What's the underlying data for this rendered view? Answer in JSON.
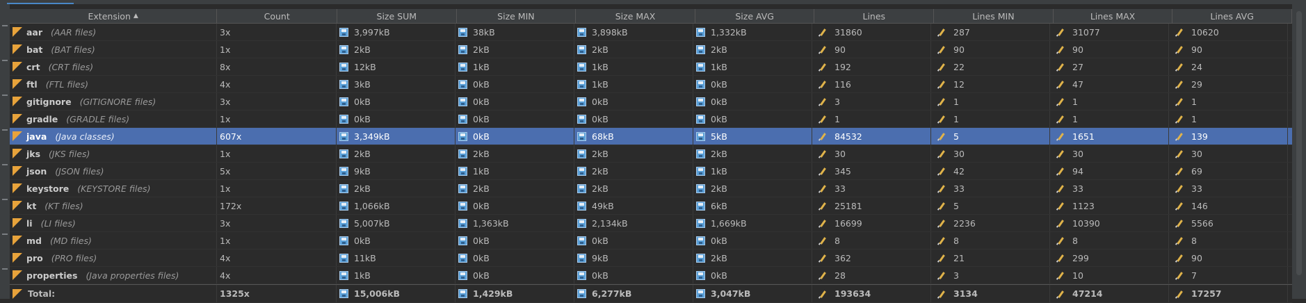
{
  "columns": [
    "Extension",
    "Count",
    "Size SUM",
    "Size MIN",
    "Size MAX",
    "Size AVG",
    "Lines",
    "Lines MIN",
    "Lines MAX",
    "Lines AVG"
  ],
  "sort_indicator": "▲",
  "rows": [
    {
      "ext": "aar",
      "desc": "(AAR files)",
      "count": "3x",
      "size_sum": "3,997kB",
      "size_min": "38kB",
      "size_max": "3,898kB",
      "size_avg": "1,332kB",
      "lines": "31860",
      "lines_min": "287",
      "lines_max": "31077",
      "lines_avg": "10620"
    },
    {
      "ext": "bat",
      "desc": "(BAT files)",
      "count": "1x",
      "size_sum": "2kB",
      "size_min": "2kB",
      "size_max": "2kB",
      "size_avg": "2kB",
      "lines": "90",
      "lines_min": "90",
      "lines_max": "90",
      "lines_avg": "90"
    },
    {
      "ext": "crt",
      "desc": "(CRT files)",
      "count": "8x",
      "size_sum": "12kB",
      "size_min": "1kB",
      "size_max": "1kB",
      "size_avg": "1kB",
      "lines": "192",
      "lines_min": "22",
      "lines_max": "27",
      "lines_avg": "24"
    },
    {
      "ext": "ftl",
      "desc": "(FTL files)",
      "count": "4x",
      "size_sum": "3kB",
      "size_min": "0kB",
      "size_max": "1kB",
      "size_avg": "0kB",
      "lines": "116",
      "lines_min": "12",
      "lines_max": "47",
      "lines_avg": "29"
    },
    {
      "ext": "gitignore",
      "desc": "(GITIGNORE files)",
      "count": "3x",
      "size_sum": "0kB",
      "size_min": "0kB",
      "size_max": "0kB",
      "size_avg": "0kB",
      "lines": "3",
      "lines_min": "1",
      "lines_max": "1",
      "lines_avg": "1"
    },
    {
      "ext": "gradle",
      "desc": "(GRADLE files)",
      "count": "1x",
      "size_sum": "0kB",
      "size_min": "0kB",
      "size_max": "0kB",
      "size_avg": "0kB",
      "lines": "1",
      "lines_min": "1",
      "lines_max": "1",
      "lines_avg": "1"
    },
    {
      "ext": "java",
      "desc": "(Java classes)",
      "count": "607x",
      "size_sum": "3,349kB",
      "size_min": "0kB",
      "size_max": "68kB",
      "size_avg": "5kB",
      "lines": "84532",
      "lines_min": "5",
      "lines_max": "1651",
      "lines_avg": "139",
      "selected": true
    },
    {
      "ext": "jks",
      "desc": "(JKS files)",
      "count": "1x",
      "size_sum": "2kB",
      "size_min": "2kB",
      "size_max": "2kB",
      "size_avg": "2kB",
      "lines": "30",
      "lines_min": "30",
      "lines_max": "30",
      "lines_avg": "30"
    },
    {
      "ext": "json",
      "desc": "(JSON files)",
      "count": "5x",
      "size_sum": "9kB",
      "size_min": "1kB",
      "size_max": "2kB",
      "size_avg": "1kB",
      "lines": "345",
      "lines_min": "42",
      "lines_max": "94",
      "lines_avg": "69"
    },
    {
      "ext": "keystore",
      "desc": "(KEYSTORE files)",
      "count": "1x",
      "size_sum": "2kB",
      "size_min": "2kB",
      "size_max": "2kB",
      "size_avg": "2kB",
      "lines": "33",
      "lines_min": "33",
      "lines_max": "33",
      "lines_avg": "33"
    },
    {
      "ext": "kt",
      "desc": "(KT files)",
      "count": "172x",
      "size_sum": "1,066kB",
      "size_min": "0kB",
      "size_max": "49kB",
      "size_avg": "6kB",
      "lines": "25181",
      "lines_min": "5",
      "lines_max": "1123",
      "lines_avg": "146"
    },
    {
      "ext": "li",
      "desc": "(LI files)",
      "count": "3x",
      "size_sum": "5,007kB",
      "size_min": "1,363kB",
      "size_max": "2,134kB",
      "size_avg": "1,669kB",
      "lines": "16699",
      "lines_min": "2236",
      "lines_max": "10390",
      "lines_avg": "5566"
    },
    {
      "ext": "md",
      "desc": "(MD files)",
      "count": "1x",
      "size_sum": "0kB",
      "size_min": "0kB",
      "size_max": "0kB",
      "size_avg": "0kB",
      "lines": "8",
      "lines_min": "8",
      "lines_max": "8",
      "lines_avg": "8"
    },
    {
      "ext": "pro",
      "desc": "(PRO files)",
      "count": "4x",
      "size_sum": "11kB",
      "size_min": "0kB",
      "size_max": "9kB",
      "size_avg": "2kB",
      "lines": "362",
      "lines_min": "21",
      "lines_max": "299",
      "lines_avg": "90"
    },
    {
      "ext": "properties",
      "desc": "(Java properties files)",
      "count": "4x",
      "size_sum": "1kB",
      "size_min": "0kB",
      "size_max": "0kB",
      "size_avg": "0kB",
      "lines": "28",
      "lines_min": "3",
      "lines_max": "10",
      "lines_avg": "7"
    }
  ],
  "total": {
    "label": "Total:",
    "count": "1325x",
    "size_sum": "15,006kB",
    "size_min": "1,429kB",
    "size_max": "6,277kB",
    "size_avg": "3,047kB",
    "lines": "193634",
    "lines_min": "3134",
    "lines_max": "47214",
    "lines_avg": "17257"
  },
  "icons": {
    "extension": "file-type-icon",
    "size": "floppy-disk-icon",
    "lines": "pencil-icon"
  },
  "colors": {
    "background": "#2b2b2b",
    "header": "#3c3f41",
    "selected_row": "#4b6eaf",
    "extension_icon": "#e8a33b",
    "disk_icon": "#5aa0d8"
  }
}
